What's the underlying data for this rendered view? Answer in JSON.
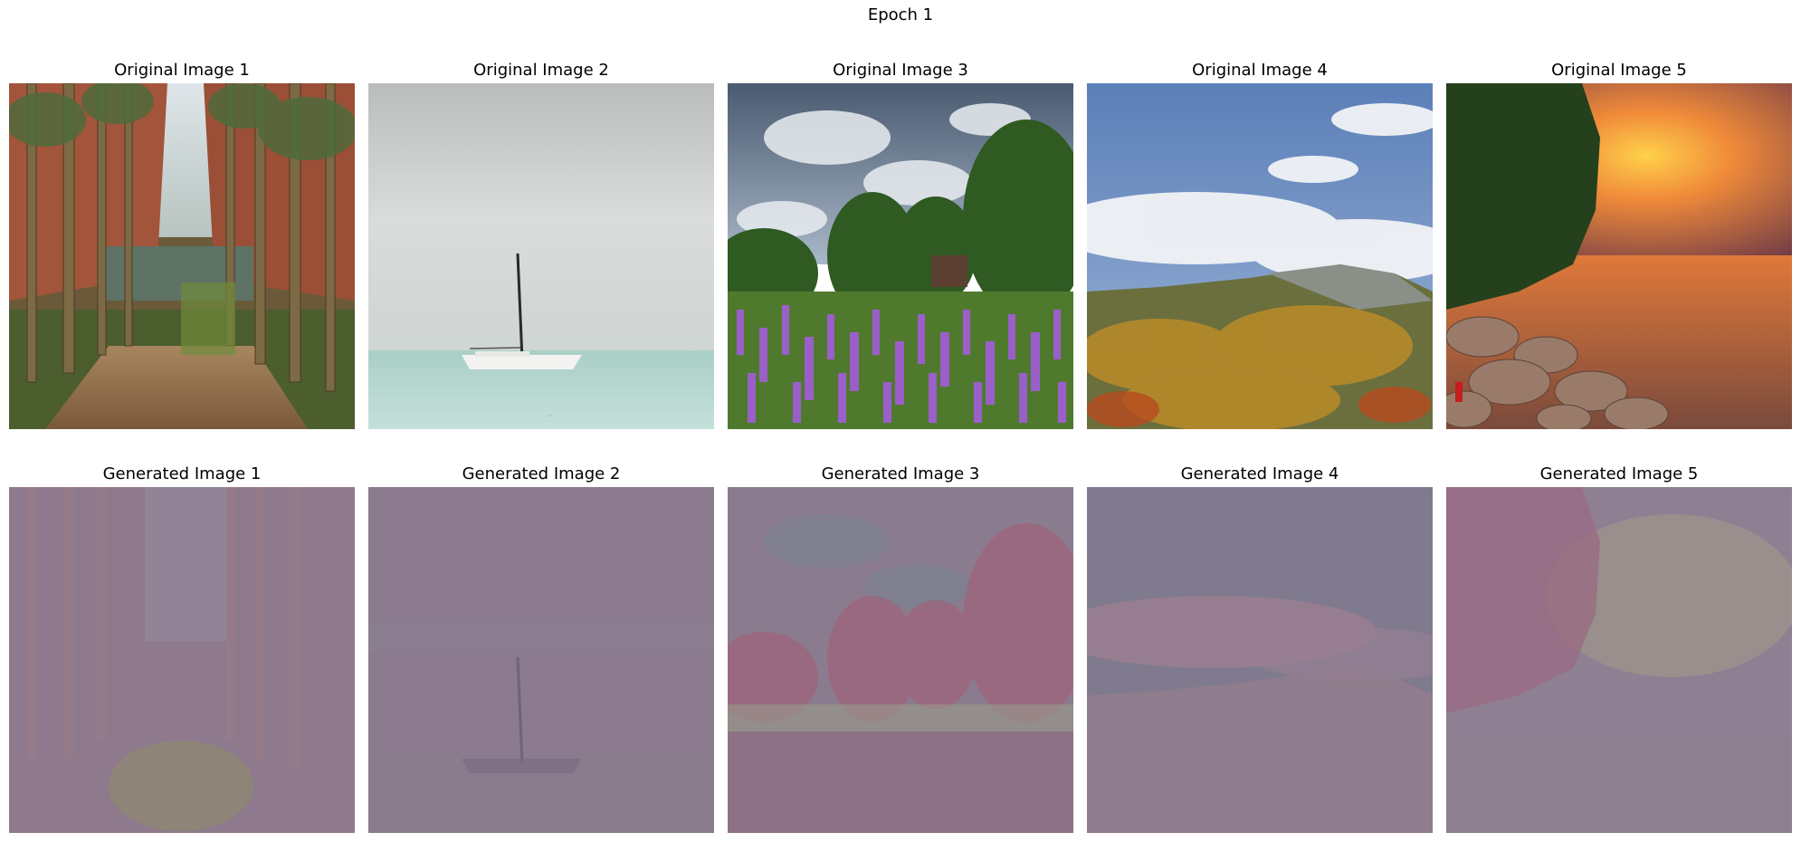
{
  "figure": {
    "suptitle": "Epoch 1"
  },
  "originals": [
    {
      "title": "Original Image 1",
      "scene": "eucalyptus trunks along a creek in a red-rock gorge"
    },
    {
      "title": "Original Image 2",
      "scene": "white catamaran sailboat on calm pale sea under grey sky"
    },
    {
      "title": "Original Image 3",
      "scene": "purple blazing-star flower field with trees and cloudy sky"
    },
    {
      "title": "Original Image 4",
      "scene": "forested mountain with autumn colors under blue sky and clouds"
    },
    {
      "title": "Original Image 5",
      "scene": "orange sunset over sea with rocky shore and trees"
    }
  ],
  "generated": [
    {
      "title": "Generated Image 1"
    },
    {
      "title": "Generated Image 2"
    },
    {
      "title": "Generated Image 3"
    },
    {
      "title": "Generated Image 4"
    },
    {
      "title": "Generated Image 5"
    }
  ],
  "colors": {
    "background": "#ffffff",
    "generated_tint": "#8e7a8c"
  }
}
